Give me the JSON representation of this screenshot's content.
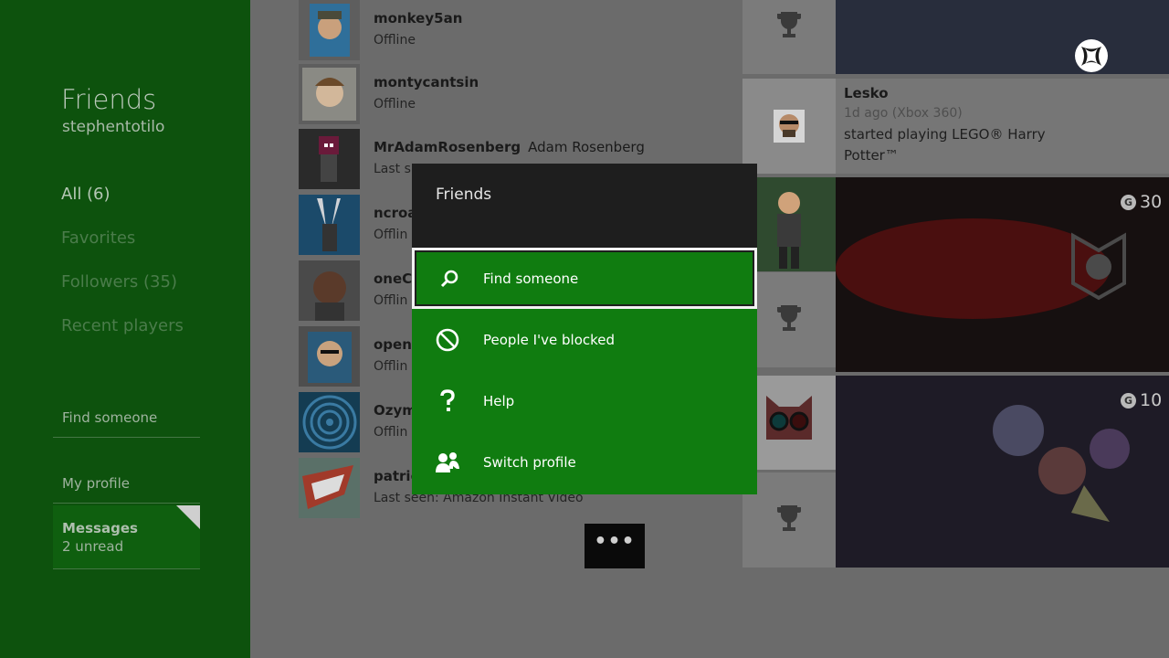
{
  "sidebar": {
    "title": "Friends",
    "username": "stephentotilo",
    "filters": [
      {
        "label": "All (6)",
        "selected": true
      },
      {
        "label": "Favorites",
        "selected": false
      },
      {
        "label": "Followers (35)",
        "selected": false
      },
      {
        "label": "Recent players",
        "selected": false
      }
    ],
    "links": {
      "find_someone": "Find someone",
      "my_profile": "My profile",
      "messages_label": "Messages",
      "messages_count": "2 unread"
    }
  },
  "friends": [
    {
      "gamertag": "monkey5an",
      "real_name": "",
      "status": "Offline"
    },
    {
      "gamertag": "montycantsin",
      "real_name": "",
      "status": "Offline"
    },
    {
      "gamertag": "MrAdamRosenberg",
      "real_name": "Adam Rosenberg",
      "status": "Last s"
    },
    {
      "gamertag": "ncroa",
      "real_name": "",
      "status": "Offlin"
    },
    {
      "gamertag": "oneC",
      "real_name": "",
      "status": "Offlin"
    },
    {
      "gamertag": "openi",
      "real_name": "",
      "status": "Offlin"
    },
    {
      "gamertag": "Ozym",
      "real_name": "",
      "status": "Offlin"
    },
    {
      "gamertag": "patric",
      "real_name": "",
      "status": "Last seen: Amazon Instant Video"
    }
  ],
  "feed": {
    "activity": {
      "name": "Lesko",
      "meta": "1d ago (Xbox 360)",
      "text_line1": "started playing LEGO® Harry",
      "text_line2": "Potter™"
    },
    "scores": [
      "30",
      "10"
    ],
    "gamerscore_glyph": "G"
  },
  "modal": {
    "title": "Friends",
    "items": [
      {
        "label": "Find someone",
        "icon": "search-icon",
        "focused": true
      },
      {
        "label": "People I've blocked",
        "icon": "blocked-icon",
        "focused": false
      },
      {
        "label": "Help",
        "icon": "help-icon",
        "focused": false
      },
      {
        "label": "Switch profile",
        "icon": "switch-profile-icon",
        "focused": false
      }
    ]
  },
  "more_button": "•••",
  "colors": {
    "xbox_green": "#107c10",
    "sidebar_green_dimmed": "#0d520d",
    "modal_dark": "#1e1e1e"
  }
}
